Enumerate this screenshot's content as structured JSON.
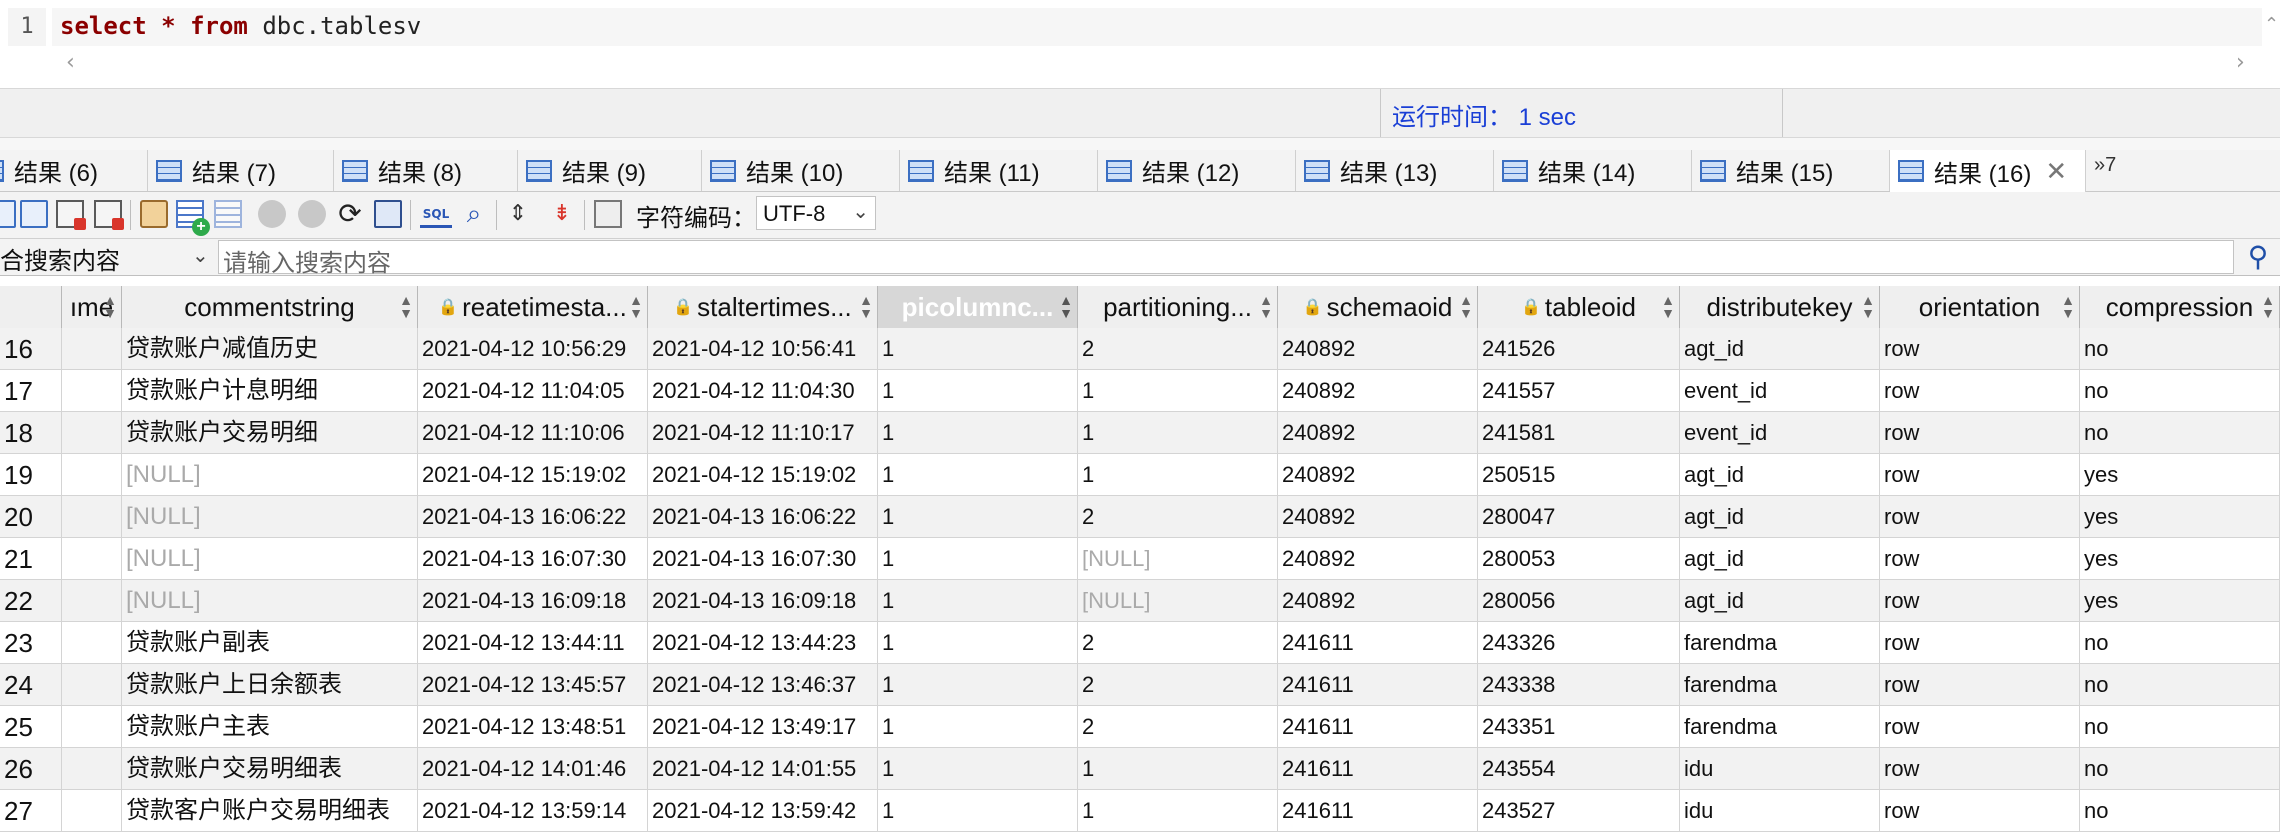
{
  "editor": {
    "line_number": "1",
    "tokens": {
      "kw1": "select",
      "op": "*",
      "kw2": "from",
      "table": "dbc.tablesv"
    },
    "scroll_left": "‹",
    "scroll_right": "›"
  },
  "status": {
    "runtime": "运行时间： 1 sec"
  },
  "tabs": [
    {
      "label": "结果 (6)"
    },
    {
      "label": "结果 (7)"
    },
    {
      "label": "结果 (8)"
    },
    {
      "label": "结果 (9)"
    },
    {
      "label": "结果 (10)"
    },
    {
      "label": "结果 (11)"
    },
    {
      "label": "结果 (12)"
    },
    {
      "label": "结果 (13)"
    },
    {
      "label": "结果 (14)"
    },
    {
      "label": "结果 (15)"
    },
    {
      "label": "结果 (16)"
    }
  ],
  "tab_overflow": "»7",
  "tab_close": "✕",
  "toolbar": {
    "encoding_label": "字符编码：",
    "encoding_value": "UTF-8",
    "refresh_glyph": "⟳",
    "sql_text": "SQL"
  },
  "search": {
    "scope": "合搜索内容",
    "placeholder": "请输入搜索内容",
    "button_glyph": "🔍"
  },
  "grid": {
    "columns": [
      "ıme",
      "commentstring",
      "reatetimesta...",
      "stalter­times...",
      "picolumnc...",
      "partitioning...",
      "schemaoid",
      "tableoid",
      "distributekey",
      "orientation",
      "compression"
    ],
    "rows": [
      {
        "n": "16",
        "comment": "贷款账户减值历史",
        "create": "2021-04-12 10:56:29",
        "alter": "2021-04-12 10:56:41",
        "pic": "1",
        "part": "2",
        "schema": "240892",
        "tableoid": "241526",
        "dist": "agt_id",
        "orient": "row",
        "comp": "no"
      },
      {
        "n": "17",
        "comment": "贷款账户计息明细",
        "create": "2021-04-12 11:04:05",
        "alter": "2021-04-12 11:04:30",
        "pic": "1",
        "part": "1",
        "schema": "240892",
        "tableoid": "241557",
        "dist": "event_id",
        "orient": "row",
        "comp": "no"
      },
      {
        "n": "18",
        "comment": "贷款账户交易明细",
        "create": "2021-04-12 11:10:06",
        "alter": "2021-04-12 11:10:17",
        "pic": "1",
        "part": "1",
        "schema": "240892",
        "tableoid": "241581",
        "dist": "event_id",
        "orient": "row",
        "comp": "no"
      },
      {
        "n": "19",
        "comment": "[NULL]",
        "create": "2021-04-12 15:19:02",
        "alter": "2021-04-12 15:19:02",
        "pic": "1",
        "part": "1",
        "schema": "240892",
        "tableoid": "250515",
        "dist": "agt_id",
        "orient": "row",
        "comp": "yes"
      },
      {
        "n": "20",
        "comment": "[NULL]",
        "create": "2021-04-13 16:06:22",
        "alter": "2021-04-13 16:06:22",
        "pic": "1",
        "part": "2",
        "schema": "240892",
        "tableoid": "280047",
        "dist": "agt_id",
        "orient": "row",
        "comp": "yes"
      },
      {
        "n": "21",
        "comment": "[NULL]",
        "create": "2021-04-13 16:07:30",
        "alter": "2021-04-13 16:07:30",
        "pic": "1",
        "part": "[NULL]",
        "schema": "240892",
        "tableoid": "280053",
        "dist": "agt_id",
        "orient": "row",
        "comp": "yes"
      },
      {
        "n": "22",
        "comment": "[NULL]",
        "create": "2021-04-13 16:09:18",
        "alter": "2021-04-13 16:09:18",
        "pic": "1",
        "part": "[NULL]",
        "schema": "240892",
        "tableoid": "280056",
        "dist": "agt_id",
        "orient": "row",
        "comp": "yes"
      },
      {
        "n": "23",
        "comment": "贷款账户副表",
        "create": "2021-04-12 13:44:11",
        "alter": "2021-04-12 13:44:23",
        "pic": "1",
        "part": "2",
        "schema": "241611",
        "tableoid": "243326",
        "dist": "farendma",
        "orient": "row",
        "comp": "no"
      },
      {
        "n": "24",
        "comment": "贷款账户上日余额表",
        "create": "2021-04-12 13:45:57",
        "alter": "2021-04-12 13:46:37",
        "pic": "1",
        "part": "2",
        "schema": "241611",
        "tableoid": "243338",
        "dist": "farendma",
        "orient": "row",
        "comp": "no"
      },
      {
        "n": "25",
        "comment": "贷款账户主表",
        "create": "2021-04-12 13:48:51",
        "alter": "2021-04-12 13:49:17",
        "pic": "1",
        "part": "2",
        "schema": "241611",
        "tableoid": "243351",
        "dist": "farendma",
        "orient": "row",
        "comp": "no"
      },
      {
        "n": "26",
        "comment": "贷款账户交易明细表",
        "create": "2021-04-12 14:01:46",
        "alter": "2021-04-12 14:01:55",
        "pic": "1",
        "part": "1",
        "schema": "241611",
        "tableoid": "243554",
        "dist": "idu",
        "orient": "row",
        "comp": "no"
      },
      {
        "n": "27",
        "comment": "贷款客户账户交易明细表",
        "create": "2021-04-12 13:59:14",
        "alter": "2021-04-12 13:59:42",
        "pic": "1",
        "part": "1",
        "schema": "241611",
        "tableoid": "243527",
        "dist": "idu",
        "orient": "row",
        "comp": "no"
      }
    ]
  }
}
